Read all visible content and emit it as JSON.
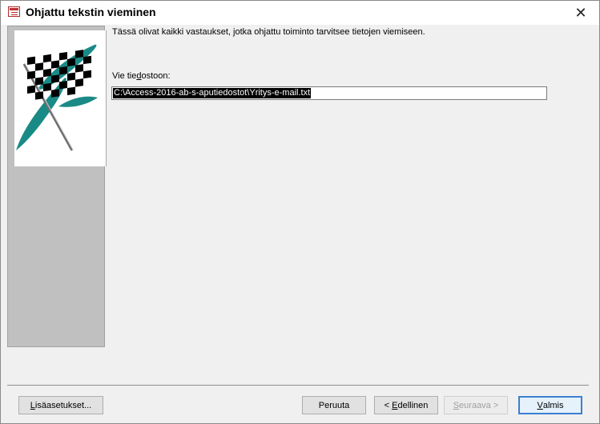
{
  "window": {
    "title": "Ohjattu tekstin vieminen",
    "close_glyph": "✕"
  },
  "main": {
    "intro": "Tässä olivat kaikki vastaukset, jotka ohjattu toiminto tarvitsee tietojen viemiseen.",
    "field_label_pre": "Vie tie",
    "field_label_accel": "d",
    "field_label_post": "ostoon:",
    "file_path": "C:\\Access-2016-ab-s-aputiedostot\\Yritys-e-mail.txt"
  },
  "buttons": {
    "advanced": {
      "pre": "",
      "accel": "L",
      "post": "isäasetukset..."
    },
    "cancel": {
      "label": "Peruuta"
    },
    "back": {
      "pre": "< ",
      "accel": "E",
      "post": "dellinen"
    },
    "next": {
      "pre": "",
      "accel": "S",
      "post": "euraava >"
    },
    "finish": {
      "pre": "",
      "accel": "V",
      "post": "almis"
    }
  },
  "icons": {
    "app": "form-icon",
    "close": "close-icon",
    "sidebar": "checkered-flag-illustration"
  },
  "colors": {
    "default_button_border": "#3c7fd0",
    "selection_bg": "#000000",
    "flag_accent": "#1a8a86"
  }
}
